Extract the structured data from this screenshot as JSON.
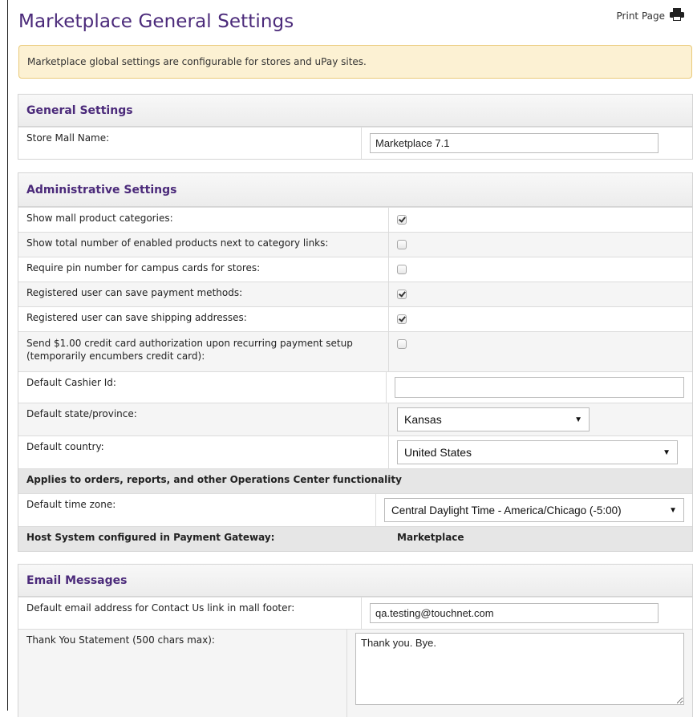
{
  "page": {
    "title": "Marketplace General Settings",
    "print_label": "Print Page"
  },
  "info_message": "Marketplace global settings are configurable for stores and uPay sites.",
  "general": {
    "heading": "General Settings",
    "store_mall_name_label": "Store Mall Name:",
    "store_mall_name_value": "Marketplace 7.1"
  },
  "admin": {
    "heading": "Administrative Settings",
    "checkbox_rows": [
      {
        "label": "Show mall product categories:",
        "checked": true
      },
      {
        "label": "Show total number of enabled products next to category links:",
        "checked": false
      },
      {
        "label": "Require pin number for campus cards for stores:",
        "checked": false
      },
      {
        "label": "Registered user can save payment methods:",
        "checked": true
      },
      {
        "label": "Registered user can save shipping addresses:",
        "checked": true
      },
      {
        "label": "Send $1.00 credit card authorization upon recurring payment setup (temporarily encumbers credit card):",
        "checked": false
      }
    ],
    "cashier_label": "Default Cashier Id:",
    "cashier_value": "",
    "state_label": "Default state/province:",
    "state_value": "Kansas",
    "country_label": "Default country:",
    "country_value": "United States",
    "ops_note": "Applies to orders, reports, and other Operations Center functionality",
    "timezone_label": "Default time zone:",
    "timezone_value": "Central Daylight Time - America/Chicago (-5:00)",
    "host_label": "Host System configured in Payment Gateway:",
    "host_value": "Marketplace"
  },
  "email": {
    "heading": "Email Messages",
    "contact_label": "Default email address for Contact Us link in mall footer:",
    "contact_value": "qa.testing@touchnet.com",
    "thankyou_label": "Thank You Statement (500 chars max):",
    "thankyou_value": "Thank you. Bye."
  }
}
